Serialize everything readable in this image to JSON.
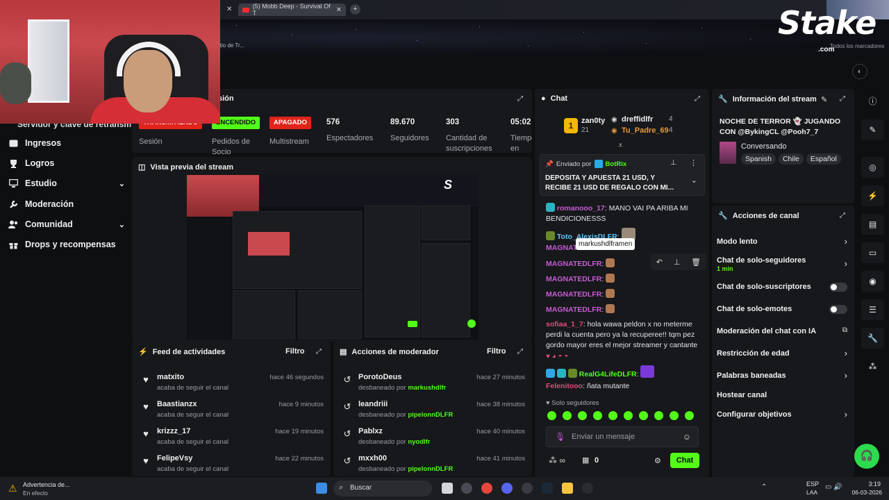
{
  "browser": {
    "tab_title": "(5) Mobb Deep - Survival Of T",
    "address_fragment": "itio de Tr...",
    "brand": "Stake",
    "brand_suffix": ".com",
    "nav_fragment": "Todos los marcadores"
  },
  "sidebar": {
    "partial_item": "Servidor y clave de retransm",
    "items": [
      {
        "label": "Ingresos",
        "icon": "wallet-icon"
      },
      {
        "label": "Logros",
        "icon": "trophy-icon"
      },
      {
        "label": "Estudio",
        "icon": "monitor-icon"
      },
      {
        "label": "Moderación",
        "icon": "wrench-icon"
      },
      {
        "label": "Comunidad",
        "icon": "users-icon"
      },
      {
        "label": "Drops y recompensas",
        "icon": "gift-icon"
      }
    ]
  },
  "stats": {
    "title_fragment": "sión",
    "badges": [
      "TRANSMITIENDO",
      "ENCENDIDO",
      "APAGADO"
    ],
    "labels": [
      "Sesión",
      "Pedidos de Socio",
      "Multistream",
      "Espectadores",
      "Seguidores",
      "Cantidad de suscripciones",
      "Tiempo en vivo"
    ],
    "values": [
      "576",
      "89.670",
      "303",
      "05:02:"
    ]
  },
  "preview": {
    "title": "Vista previa del stream"
  },
  "feed": {
    "title": "Feed de actividades",
    "filter": "Filtro",
    "items": [
      {
        "name": "matxito",
        "action": "acaba de seguir el canal",
        "time": "hace 46 segundos"
      },
      {
        "name": "Baastianzx",
        "action": "acaba de seguir el canal",
        "time": "hace 9 minutos"
      },
      {
        "name": "krizzz_17",
        "action": "acaba de seguir el canal",
        "time": "hace 19 minutos"
      },
      {
        "name": "FelipeVsy",
        "action": "acaba de seguir el canal",
        "time": "hace 22 minutos"
      }
    ]
  },
  "moderator": {
    "title": "Acciones de moderador",
    "filter": "Filtro",
    "items": [
      {
        "name": "PorotoDeus",
        "action": "desbaneado por",
        "by": "markushdlfr",
        "time": "hace 27 minutos"
      },
      {
        "name": "leandriii",
        "action": "desbaneado por",
        "by": "pipelonnDLFR",
        "time": "hace 38 minutos"
      },
      {
        "name": "Pablxz",
        "action": "desbaneado por",
        "by": "nyodlfr",
        "time": "hace 40 minutos"
      },
      {
        "name": "mxxh00",
        "action": "desbaneado por",
        "by": "pipelonnDLFR",
        "time": "hace 41 minutos"
      }
    ]
  },
  "chat": {
    "title": "Chat",
    "leaders": [
      {
        "rank": "1",
        "name": "zan0ty",
        "count": "21"
      },
      {
        "name": "dreffidlfr",
        "count": "4"
      },
      {
        "name": "Tu_Padre_69",
        "count": "4"
      }
    ],
    "pinned": {
      "sent_by": "Enviado por",
      "bot": "BotRix",
      "text": "DEPOSITA Y APUESTA 21 USD, Y RECIBE 21 USD DE REGALO CON MI..."
    },
    "messages": [
      {
        "user": "romanooo_17",
        "text": "MANO VAI PA ARIBA MI BENDICIONESSS"
      },
      {
        "user": "Toto_AlexisDLFR",
        "text": ""
      },
      {
        "user": "MAGNATEDLFR",
        "text": ""
      },
      {
        "user": "MAGNATEDLFR",
        "text": ""
      },
      {
        "user": "MAGNATEDLFR",
        "text": ""
      },
      {
        "user": "MAGNATEDLFR",
        "text": ""
      },
      {
        "user": "MAGNATEDLFR",
        "text": ""
      },
      {
        "user": "sofiaa_1_7",
        "text": "hola wawa peldon x no meterme perdi la cuenta pero ya la recuperee!! tqm pez gordo mayor eres el mejor streamer y cantante"
      },
      {
        "user": "RealG4LifeDLFR",
        "text": ""
      },
      {
        "user": "Felenitooo",
        "text": "ñata mutante"
      }
    ],
    "tooltip": "markushdlframen",
    "followers_only": "Solo seguidores",
    "input_placeholder": "Enviar un mensaje",
    "points": "0",
    "send": "Chat"
  },
  "info": {
    "title": "Información del stream",
    "stream_title": "NOCHE DE TERROR 👻 JUGANDO CON @BykingCL @Pooh7_7",
    "category": "Conversando",
    "tags": [
      "Spanish",
      "Chile",
      "Español"
    ]
  },
  "actions": {
    "title": "Acciones de canal",
    "items": [
      {
        "label": "Modo lento",
        "control": "chevron"
      },
      {
        "label": "Chat de solo-seguidores",
        "sub": "1 min",
        "control": "chevron"
      },
      {
        "label": "Chat de solo-suscriptores",
        "control": "toggle"
      },
      {
        "label": "Chat de solo-emotes",
        "control": "toggle"
      },
      {
        "label": "Moderación del chat con IA",
        "control": "external"
      },
      {
        "label": "Restricción de edad",
        "control": "chevron"
      },
      {
        "label": "Palabras baneadas",
        "control": "chevron"
      },
      {
        "label": "Hostear canal",
        "control": "none"
      },
      {
        "label": "Configurar objetivos",
        "control": "chevron"
      }
    ]
  },
  "taskbar": {
    "notification_title": "Advertencia de...",
    "notification_sub": "En efecto",
    "search": "Buscar",
    "lang": "ESP",
    "lang_sub": "LAA",
    "time": "3:19",
    "date": "06-03-2026"
  },
  "colors": {
    "accent": "#53fc18",
    "danger": "#e2231a",
    "panel": "#17181b"
  }
}
